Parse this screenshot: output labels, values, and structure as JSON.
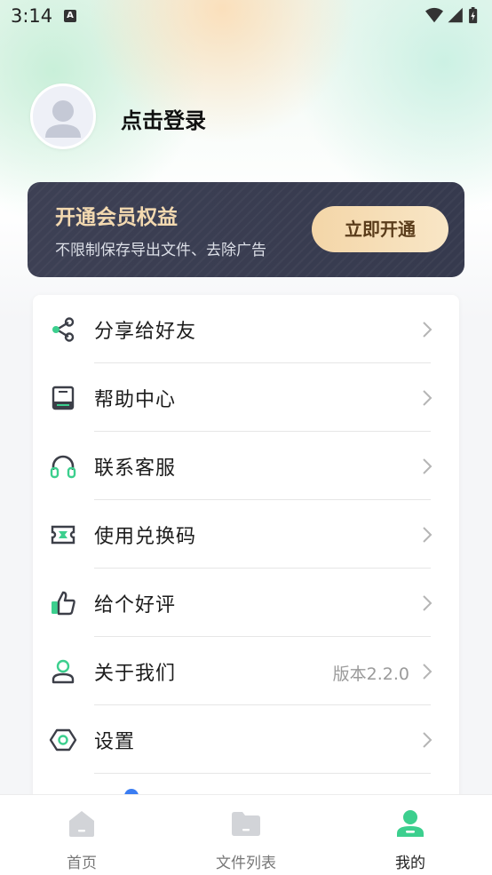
{
  "status_bar": {
    "time": "3:14",
    "notification_badge": "A"
  },
  "profile": {
    "login_label": "点击登录"
  },
  "vip": {
    "title": "开通会员权益",
    "subtitle": "不限制保存导出文件、去除广告",
    "button_label": "立即开通"
  },
  "menu": {
    "items": [
      {
        "label": "分享给好友",
        "icon": "share-icon",
        "extra": ""
      },
      {
        "label": "帮助中心",
        "icon": "book-icon",
        "extra": ""
      },
      {
        "label": "联系客服",
        "icon": "headset-icon",
        "extra": ""
      },
      {
        "label": "使用兑换码",
        "icon": "ticket-icon",
        "extra": ""
      },
      {
        "label": "给个好评",
        "icon": "thumbs-up-icon",
        "extra": ""
      },
      {
        "label": "关于我们",
        "icon": "user-icon",
        "extra": "版本2.2.0"
      },
      {
        "label": "设置",
        "icon": "settings-icon",
        "extra": ""
      }
    ]
  },
  "tabbar": {
    "tabs": [
      {
        "label": "首页",
        "icon": "home-icon",
        "active": false
      },
      {
        "label": "文件列表",
        "icon": "folder-icon",
        "active": false
      },
      {
        "label": "我的",
        "icon": "profile-icon",
        "active": true
      }
    ]
  },
  "colors": {
    "accent": "#3ccf8e",
    "icon_dark": "#3c3f48",
    "vip_bg": "#3a3d51",
    "vip_gold": "#f3d9b0",
    "inactive_tab": "#d2d4d8"
  }
}
